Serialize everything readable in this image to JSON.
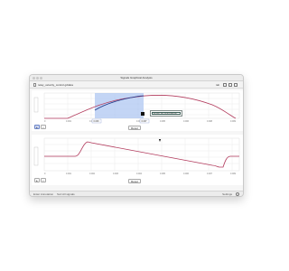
{
  "window": {
    "title": "Signals Graphical Analysis"
  },
  "toolbar": {
    "file_name": "relay_velocity_control.g2data",
    "buttons": [
      "tab",
      "bookmark",
      "export",
      "help"
    ]
  },
  "top_panel": {
    "highlight_start_label": "0.003",
    "highlight_end_label": "0.007",
    "annotation_placeholder": "Enter an annotation",
    "center_button_label": "Reset"
  },
  "bottom_panel": {
    "center_button_label": "Reset"
  },
  "status": {
    "left": "Enter Annotation",
    "middle": "Sort All signals",
    "right": "Settings"
  },
  "colors": {
    "signal": "#b23a5c",
    "selection": "#a9c3f1",
    "grid": "#e7e7e7"
  }
}
